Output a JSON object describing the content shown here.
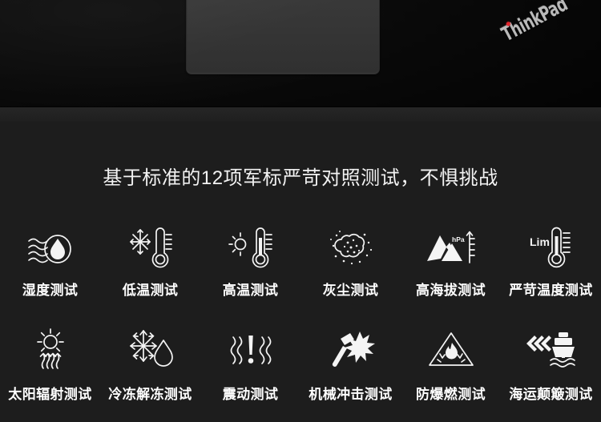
{
  "product": {
    "brand_logo_text": "ThinkPad",
    "brand_logo_dot_color": "#e2242b"
  },
  "headline": "基于标准的12项军标严苛对照测试，不惧挑战",
  "theme": {
    "background": "#1d1d1d",
    "palmrest": "#343434",
    "text": "#ffffff",
    "icon_stroke": "#f4f4f4"
  },
  "tests": {
    "row1": [
      {
        "label": "湿度测试",
        "icon": "humidity-waves-droplet-icon"
      },
      {
        "label": "低温测试",
        "icon": "snowflake-thermometer-icon"
      },
      {
        "label": "高温测试",
        "icon": "sun-thermometer-icon"
      },
      {
        "label": "灰尘测试",
        "icon": "dust-cloud-icon"
      },
      {
        "label": "高海拔测试",
        "icon": "mountain-altitude-icon",
        "annotation": "hPa"
      },
      {
        "label": "严苛温度测试",
        "icon": "limit-thermometer-icon",
        "annotation": "Lim"
      }
    ],
    "row2": [
      {
        "label": "太阳辐射测试",
        "icon": "solar-radiation-icon"
      },
      {
        "label": "冷冻解冻测试",
        "icon": "freeze-thaw-icon"
      },
      {
        "label": "震动测试",
        "icon": "vibration-exclamation-icon"
      },
      {
        "label": "机械冲击测试",
        "icon": "hammer-impact-icon"
      },
      {
        "label": "防爆燃测试",
        "icon": "flame-warning-triangle-icon"
      },
      {
        "label": "海运颠簸测试",
        "icon": "ship-waves-icon"
      }
    ]
  }
}
